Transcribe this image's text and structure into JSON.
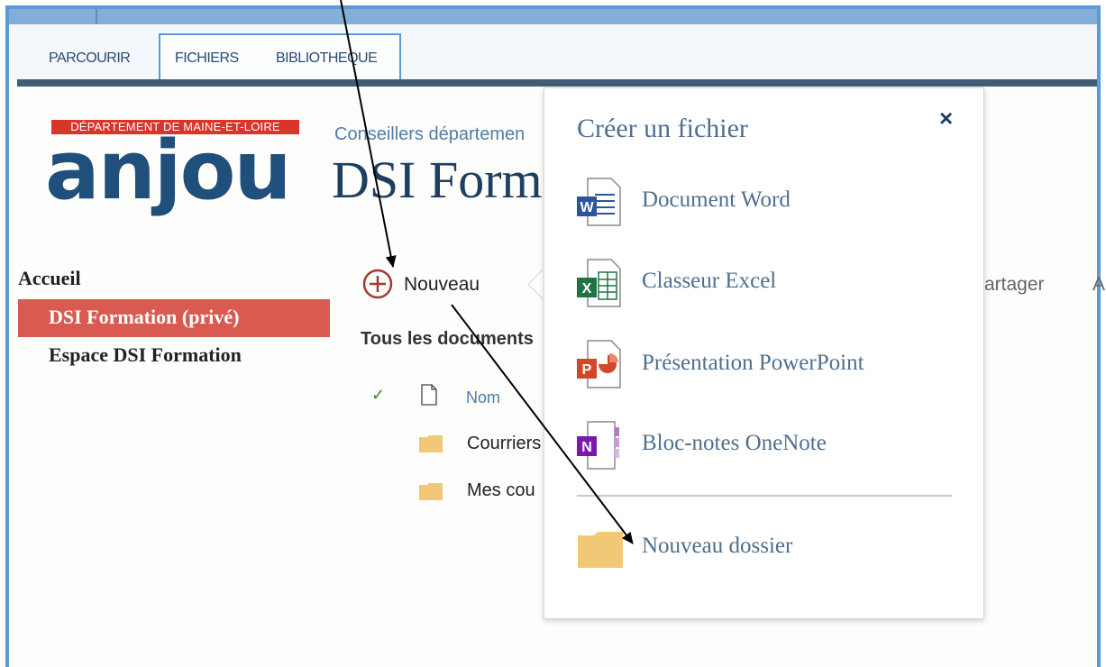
{
  "ribbon": {
    "tabs": [
      {
        "label": "PARCOURIR"
      },
      {
        "label": "FICHIERS"
      },
      {
        "label": "BIBLIOTHEQUE"
      }
    ]
  },
  "logo": {
    "top_text": "DÉPARTEMENT DE MAINE-ET-LOIRE",
    "main_text": "anjou"
  },
  "site": {
    "subtitle": "Conseillers départemen",
    "title": "DSI Form"
  },
  "nav": {
    "items": [
      {
        "label": "Accueil"
      },
      {
        "label": "DSI Formation (privé)"
      },
      {
        "label": "Espace DSI Formation"
      }
    ]
  },
  "toolbar": {
    "new_label": "Nouveau",
    "share_label": "artager",
    "extra_label": "A"
  },
  "library": {
    "view_label": "Tous les documents",
    "column_name": "Nom",
    "rows": [
      {
        "name": "Courriers"
      },
      {
        "name": "Mes cou"
      }
    ]
  },
  "panel": {
    "title": "Créer un fichier",
    "close_label": "×",
    "items": [
      {
        "label": "Document Word",
        "icon": "word-icon",
        "color": "#2b579a"
      },
      {
        "label": "Classeur Excel",
        "icon": "excel-icon",
        "color": "#217346"
      },
      {
        "label": "Présentation PowerPoint",
        "icon": "powerpoint-icon",
        "color": "#d24726"
      },
      {
        "label": "Bloc-notes OneNote",
        "icon": "onenote-icon",
        "color": "#7719aa"
      }
    ],
    "folder_label": "Nouveau dossier"
  },
  "colors": {
    "accent": "#5b9bd5",
    "nav_active": "#d95a50",
    "folder": "#f2c877"
  }
}
